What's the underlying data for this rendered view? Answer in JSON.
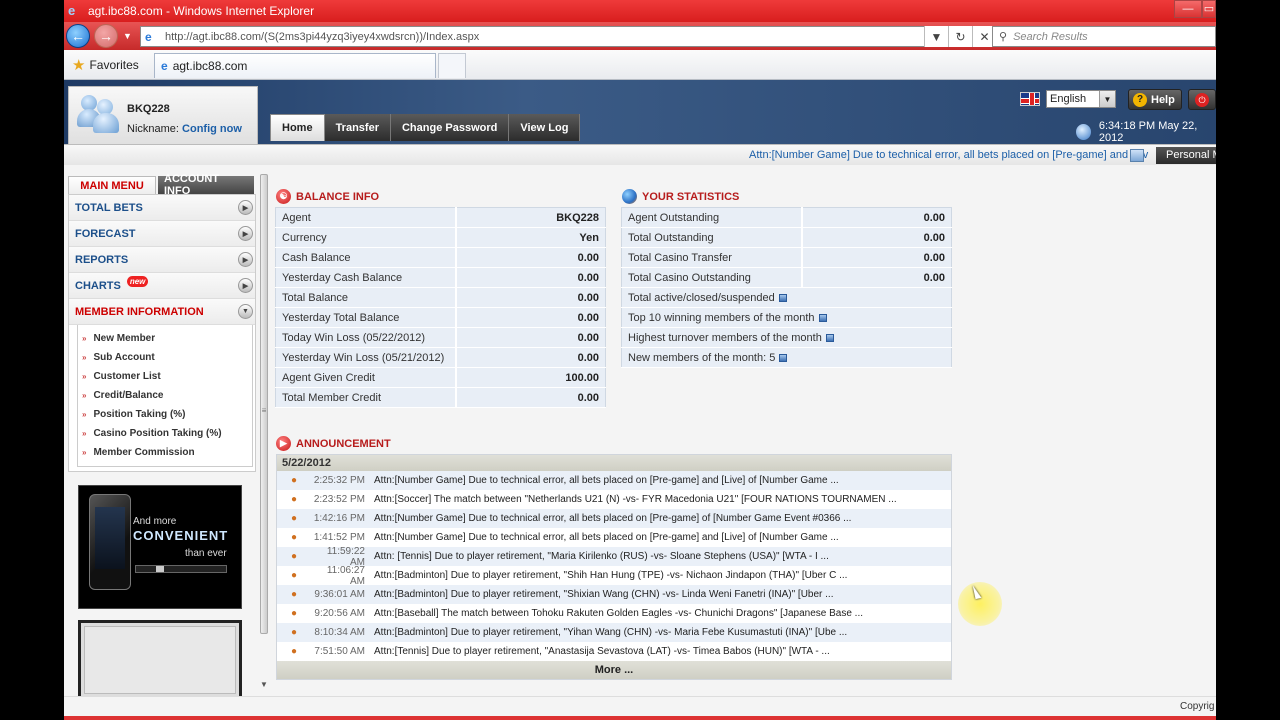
{
  "window": {
    "title": "agt.ibc88.com - Windows Internet Explorer"
  },
  "browser": {
    "url": "http://agt.ibc88.com/(S(2ms3pi44yzq3iyey4xwdsrcn))/Index.aspx",
    "search_placeholder": "Search Results",
    "favorites_label": "Favorites",
    "tab_title": "agt.ibc88.com",
    "min_label": "—",
    "max_label": "▭"
  },
  "header": {
    "username": "BKQ228",
    "nickname_label": "Nickname:",
    "nickname_link": "Config now",
    "language": "English",
    "help_label": "Help",
    "clock": "6:34:18 PM May 22, 2012",
    "marquee": "Attn:[Number Game] Due to technical error, all bets placed on [Pre-game] and [Liv",
    "personal_label": "Personal M"
  },
  "nav_tabs": [
    "Home",
    "Transfer",
    "Change Password",
    "View Log"
  ],
  "sidebar": {
    "tab_main": "MAIN MENU",
    "tab_account": "ACCOUNT INFO",
    "menu": [
      "TOTAL BETS",
      "FORECAST",
      "REPORTS",
      "CHARTS",
      "MEMBER INFORMATION"
    ],
    "new_badge": "new",
    "submenu": [
      "New Member",
      "Sub Account",
      "Customer List",
      "Credit/Balance",
      "Position Taking (%)",
      "Casino Position Taking (%)",
      "Member Commission"
    ],
    "promo": {
      "line1": "And more",
      "line2": "CONVENIENT",
      "line3": "than ever"
    }
  },
  "balance": {
    "title": "BALANCE INFO",
    "rows": [
      {
        "label": "Agent",
        "value": "BKQ228"
      },
      {
        "label": "Currency",
        "value": "Yen"
      },
      {
        "label": "Cash Balance",
        "value": "0.00"
      },
      {
        "label": "Yesterday Cash Balance",
        "value": "0.00"
      },
      {
        "label": "Total Balance",
        "value": "0.00"
      },
      {
        "label": "Yesterday Total Balance",
        "value": "0.00"
      },
      {
        "label": "Today Win Loss (05/22/2012)",
        "value": "0.00"
      },
      {
        "label": "Yesterday Win Loss (05/21/2012)",
        "value": "0.00"
      },
      {
        "label": "Agent Given Credit",
        "value": "100.00"
      },
      {
        "label": "Total Member Credit",
        "value": "0.00"
      }
    ]
  },
  "stats": {
    "title": "YOUR STATISTICS",
    "rows": [
      {
        "label": "Agent Outstanding",
        "value": "0.00"
      },
      {
        "label": "Total Outstanding",
        "value": "0.00"
      },
      {
        "label": "Total Casino Transfer",
        "value": "0.00"
      },
      {
        "label": "Total Casino Outstanding",
        "value": "0.00"
      }
    ],
    "links": [
      "Total active/closed/suspended",
      "Top 10 winning members of the month",
      "Highest turnover members of the month",
      "New members of the month: 5"
    ]
  },
  "announcement": {
    "title": "ANNOUNCEMENT",
    "date": "5/22/2012",
    "more_label": "More ...",
    "items": [
      {
        "time": "2:25:32 PM",
        "text": "Attn:[Number Game] Due to technical error, all bets placed on [Pre-game] and [Live] of [Number Game ..."
      },
      {
        "time": "2:23:52 PM",
        "text": "Attn:[Soccer] The match between \"Netherlands U21 (N) -vs- FYR Macedonia U21\" [FOUR NATIONS TOURNAMEN ..."
      },
      {
        "time": "1:42:16 PM",
        "text": "Attn:[Number Game] Due to technical error, all bets placed on [Pre-game] of [Number Game Event #0366 ..."
      },
      {
        "time": "1:41:52 PM",
        "text": "Attn:[Number Game] Due to technical error, all bets placed on [Pre-game] and [Live] of [Number Game ..."
      },
      {
        "time": "11:59:22 AM",
        "text": "Attn: [Tennis] Due to player retirement, \"Maria Kirilenko (RUS) -vs- Sloane Stephens (USA)\" [WTA - I ..."
      },
      {
        "time": "11:06:27 AM",
        "text": "Attn:[Badminton] Due to player retirement, \"Shih Han Hung (TPE) -vs- Nichaon Jindapon (THA)\" [Uber C ..."
      },
      {
        "time": "9:36:01 AM",
        "text": "Attn:[Badminton] Due to player retirement, \"Shixian Wang (CHN) -vs- Linda Weni Fanetri (INA)\" [Uber ..."
      },
      {
        "time": "9:20:56 AM",
        "text": "Attn:[Baseball] The match between Tohoku Rakuten Golden Eagles -vs- Chunichi Dragons\" [Japanese Base ..."
      },
      {
        "time": "8:10:34 AM",
        "text": "Attn:[Badminton] Due to player retirement, \"Yihan Wang (CHN) -vs- Maria Febe Kusumastuti (INA)\" [Ube ..."
      },
      {
        "time": "7:51:50 AM",
        "text": "Attn:[Tennis] Due to player retirement, \"Anastasija Sevastova (LAT) -vs- Timea Babos (HUN)\" [WTA - ..."
      }
    ]
  },
  "footer": {
    "copyright": "Copyrig"
  },
  "colors": {
    "ie_chrome": "#d91e1e",
    "header_dark": "#1e3a64",
    "accent_red": "#b71c1c",
    "link_blue": "#1c5fa8"
  }
}
